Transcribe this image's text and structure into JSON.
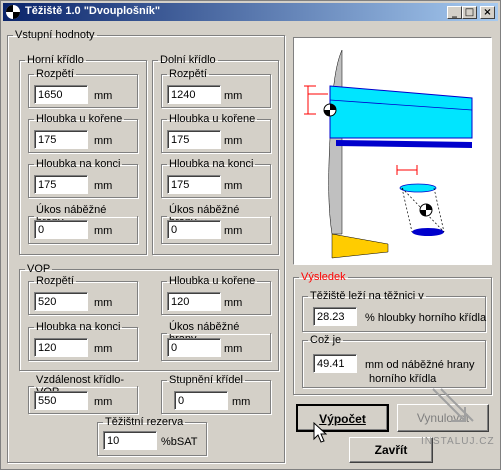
{
  "window": {
    "title": "Těžiště 1.0 \"Dvouplošník\"",
    "minimize": "_",
    "maximize": "□",
    "close": "×"
  },
  "inputs": {
    "title": "Vstupní hodnoty",
    "upper_wing": {
      "title": "Horní křídlo",
      "span_label": "Rozpětí",
      "span": "1650",
      "span_unit": "mm",
      "root_label": "Hloubka u kořene",
      "root": "175",
      "root_unit": "mm",
      "tip_label": "Hloubka na konci",
      "tip": "175",
      "tip_unit": "mm",
      "sweep_label": "Úkos náběžné hrany",
      "sweep": "0",
      "sweep_unit": "mm"
    },
    "lower_wing": {
      "title": "Dolní křídlo",
      "span_label": "Rozpětí",
      "span": "1240",
      "span_unit": "mm",
      "root_label": "Hloubka u kořene",
      "root": "175",
      "root_unit": "mm",
      "tip_label": "Hloubka na konci",
      "tip": "175",
      "tip_unit": "mm",
      "sweep_label": "Úkos náběžné hrany",
      "sweep": "0",
      "sweep_unit": "mm"
    },
    "vop": {
      "title": "VOP",
      "span_label": "Rozpětí",
      "span": "520",
      "span_unit": "mm",
      "root_label": "Hloubka u kořene",
      "root": "120",
      "root_unit": "mm",
      "tip_label": "Hloubka na konci",
      "tip": "120",
      "tip_unit": "mm",
      "sweep_label": "Úkos náběžné hrany",
      "sweep": "0",
      "sweep_unit": "mm"
    },
    "distance": {
      "label": "Vzdálenost křídlo-VOP",
      "value": "550",
      "unit": "mm"
    },
    "stagger": {
      "label": "Stupnění křídel",
      "value": "0",
      "unit": "mm"
    },
    "reserve": {
      "label": "Těžištní rezerva",
      "value": "10",
      "unit": "%bSAT"
    }
  },
  "result": {
    "title": "Výsledek",
    "cg_label": "Těžiště leží na těžnici v",
    "cg_value": "28.23",
    "cg_unit": "% hloubky horního křídla",
    "co_label": "Což je",
    "co_value": "49.41",
    "co_unit_1": "mm od náběžné hrany",
    "co_unit_2": "horního křídla"
  },
  "buttons": {
    "compute": "Výpočet",
    "reset": "Vynulovat",
    "close": "Zavřít"
  },
  "watermark": "INSTALUJ.CZ",
  "colors": {
    "wing": "#00e5ff",
    "wing_lower": "#0000cc",
    "tail": "#ffcc00",
    "dimension": "#ff0000",
    "result_legend": "#ff0000"
  }
}
